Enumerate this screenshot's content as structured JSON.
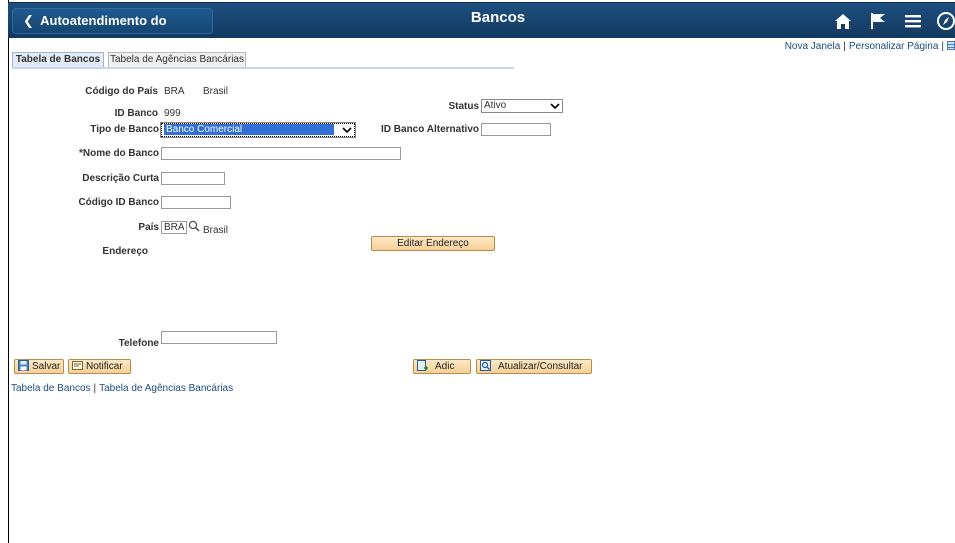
{
  "header": {
    "back_label": "Autoatendimento do Gerente",
    "title": "Bancos",
    "icons": [
      "home-icon",
      "flag-icon",
      "menu-icon",
      "compass-icon"
    ]
  },
  "top_links": {
    "new_window": "Nova Janela",
    "personalize": "Personalizar Página"
  },
  "tabs": [
    {
      "label": "Tabela de Bancos",
      "active": true
    },
    {
      "label": "Tabela de Agências Bancárias",
      "active": false
    }
  ],
  "form": {
    "country_code_label": "Código do País",
    "country_code_value": "BRA",
    "country_name": "Brasil",
    "bank_id_label": "ID Banco",
    "bank_id_value": "999",
    "status_label": "Status",
    "status_value": "Ativo",
    "bank_type_label": "Tipo de Banco",
    "bank_type_value": "Banco Comercial",
    "alt_bank_id_label": "ID Banco Alternativo",
    "alt_bank_id_value": "",
    "bank_name_label": "*Nome do Banco",
    "bank_name_value": "",
    "short_desc_label": "Descrição Curta",
    "short_desc_value": "",
    "bank_code_label": "Código ID Banco",
    "bank_code_value": "",
    "country_label": "País",
    "country_value": "BRA",
    "country_desc": "Brasil",
    "address_label": "Endereço",
    "edit_address_button": "Editar Endereço",
    "phone_label": "Telefone",
    "phone_value": ""
  },
  "toolbar": {
    "save": "Salvar",
    "notify": "Notificar",
    "add": "Adic",
    "update": "Atualizar/Consultar"
  },
  "bottom_links": {
    "bank_table": "Tabela de Bancos",
    "branch_table": "Tabela de Agências Bancárias"
  }
}
